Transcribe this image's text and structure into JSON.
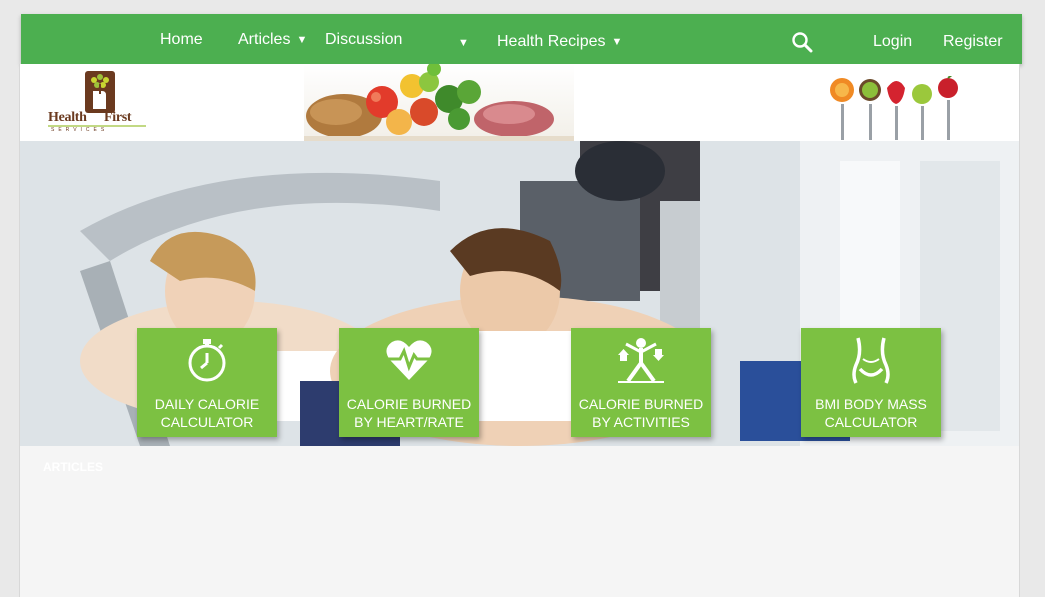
{
  "nav": {
    "home": "Home",
    "articles": "Articles",
    "discussion": "Discussion",
    "recipes": "Health Recipes",
    "login": "Login",
    "register": "Register",
    "caret": "▼"
  },
  "logo": {
    "word1": "Health",
    "word2": "First",
    "sub": "SERVICES"
  },
  "tiles": [
    {
      "line1": "DAILY CALORIE",
      "line2": "CALCULATOR",
      "icon": "stopwatch-icon"
    },
    {
      "line1": "CALORIE BURNED",
      "line2": "BY HEART/RATE",
      "icon": "heart-pulse-icon"
    },
    {
      "line1": "CALORIE BURNED",
      "line2": "BY ACTIVITIES",
      "icon": "exercise-icon"
    },
    {
      "line1": "BMI BODY MASS",
      "line2": "CALCULATOR",
      "icon": "body-icon"
    }
  ],
  "articles": {
    "title": "ARTICLES"
  },
  "colors": {
    "nav_green": "#4caf50",
    "tile_green": "#7cc142",
    "logo_brown": "#6b3a1f"
  }
}
